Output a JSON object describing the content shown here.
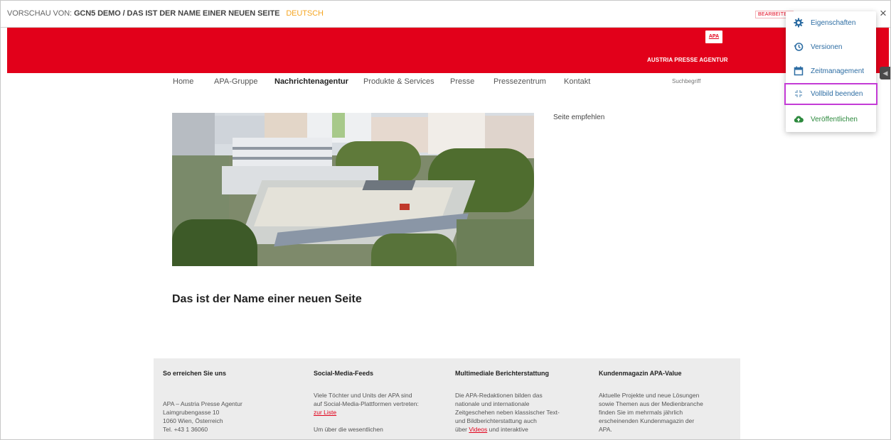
{
  "preview_bar": {
    "prefix": "VORSCHAU VON:",
    "path": "GCN5 DEMO / DAS IST DER NAME EINER NEUEN SEITE",
    "language": "DEUTSCH",
    "status_badge": "BEARBEITET",
    "close_glyph": "×"
  },
  "site": {
    "logo_text": "APA",
    "claim": "AUSTRIA PRESSE AGENTUR",
    "brand_color": "#e2001a",
    "side_handle_glyph": "◀"
  },
  "nav": {
    "items": [
      {
        "label": "Home",
        "active": false
      },
      {
        "label": "APA-Gruppe",
        "active": false
      },
      {
        "label": "Nachrichtenagentur",
        "active": true
      },
      {
        "label": "Produkte & Services",
        "active": false
      },
      {
        "label": "Presse",
        "active": false
      },
      {
        "label": "Pressezentrum",
        "active": false
      },
      {
        "label": "Kontakt",
        "active": false
      }
    ],
    "search_placeholder": "Suchbegriff"
  },
  "content": {
    "share_link": "Seite empfehlen",
    "heading": "Das ist der Name einer neuen Seite",
    "hero_image": "aerial photo of office buildings"
  },
  "footer": {
    "columns": [
      {
        "heading": "So erreichen Sie uns",
        "lines": [
          "APA – Austria Presse Agentur",
          "Laimgrubengasse 10",
          "1060 Wien, Österreich",
          "Tel. +43 1 36060"
        ]
      },
      {
        "heading": "Social-Media-Feeds",
        "lines": [
          "Viele Töchter und Units der APA sind",
          "auf Social-Media-Plattformen vertreten:"
        ],
        "link": "zur Liste",
        "lines2": [
          "Um über die wesentlichen"
        ]
      },
      {
        "heading": "Multimediale Berichterstattung",
        "lines": [
          "Die APA-Redaktionen bilden das",
          "nationale und internationale",
          "Zeitgeschehen neben klassischer Text-",
          "und Bildberichterstattung auch"
        ],
        "last_prefix": "über",
        "last_link": "Videos",
        "last_suffix": "und interaktive"
      },
      {
        "heading": "Kundenmagazin APA-Value",
        "lines": [
          "Aktuelle Projekte und neue Lösungen",
          "sowie Themen aus der Medienbranche",
          "finden Sie im mehrmals jährlich",
          "erscheinenden Kundenmagazin der",
          "APA."
        ]
      }
    ]
  },
  "menu": {
    "items": [
      {
        "label": "Eigenschaften",
        "icon": "gear-icon"
      },
      {
        "label": "Versionen",
        "icon": "history-icon"
      },
      {
        "label": "Zeitmanagement",
        "icon": "calendar-icon"
      },
      {
        "label": "Vollbild beenden",
        "icon": "exit-fullscreen-icon",
        "highlighted": true
      },
      {
        "label": "Veröffentlichen",
        "icon": "cloud-upload-icon"
      }
    ],
    "highlight_color": "#c43bd6",
    "link_color": "#2d6da3",
    "publish_color": "#2d8a3e"
  }
}
